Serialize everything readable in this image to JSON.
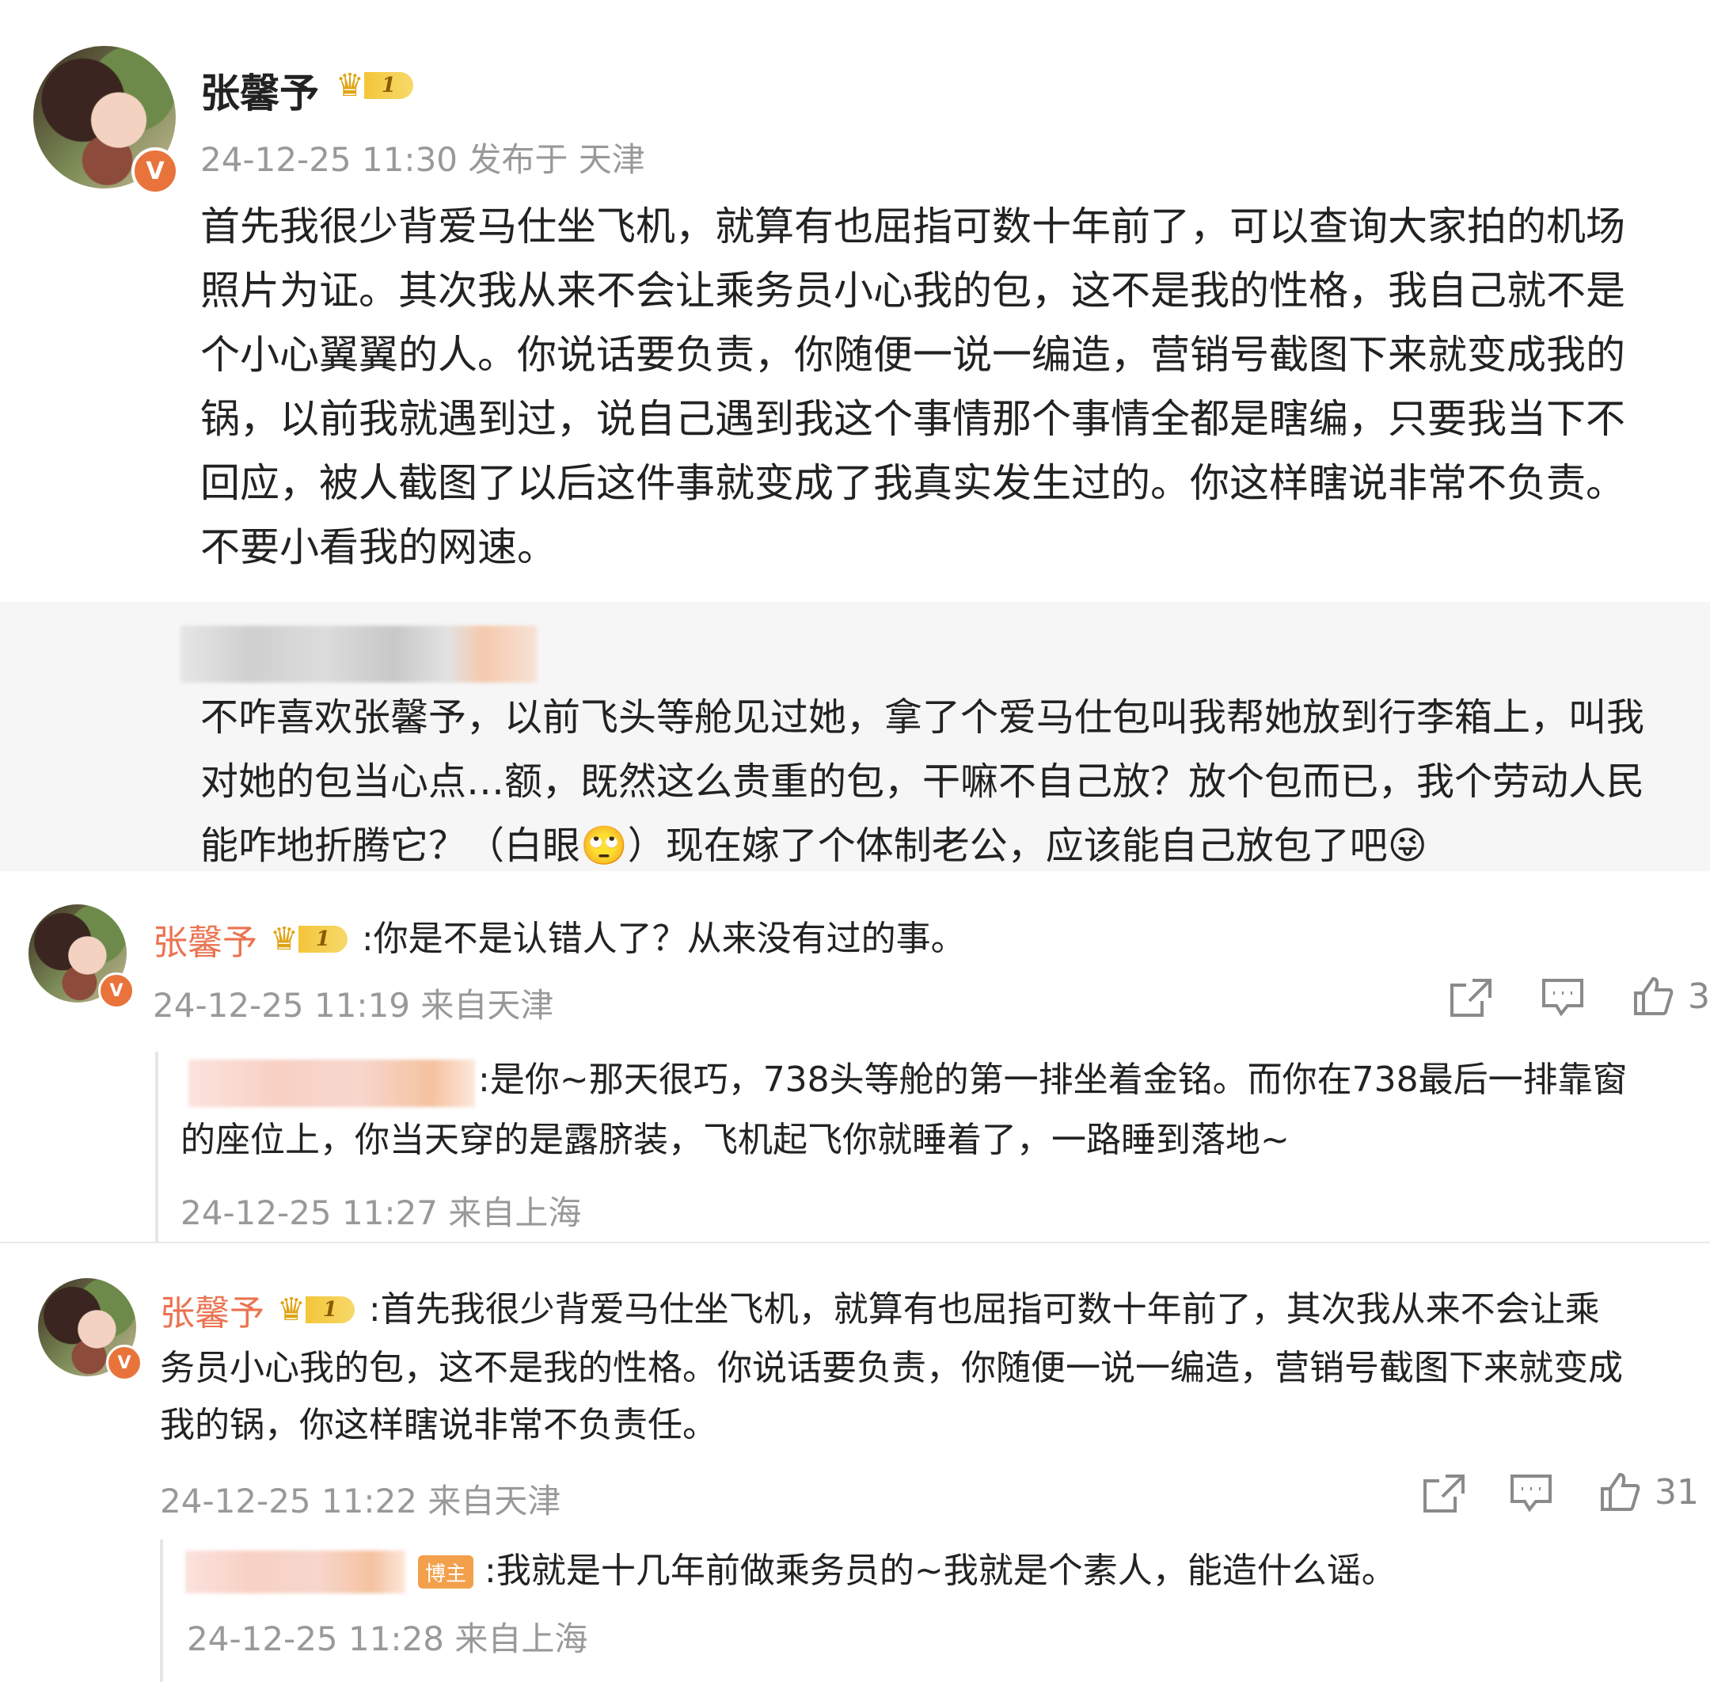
{
  "post": {
    "author": "张馨予",
    "vip_level": "1",
    "verified_mark": "V",
    "meta": "24-12-25 11:30 发布于 天津",
    "lines": [
      "首先我很少背爱马仕坐飞机，就算有也屈指可数十年前了，可以查询大家拍的机场",
      "照片为证。其次我从来不会让乘务员小心我的包，这不是我的性格，我自己就不是",
      "个小心翼翼的人。你说话要负责，你随便一说一编造，营销号截图下来就变成我的",
      "锅，以前我就遇到过，说自己遇到我这个事情那个事情全都是瞎编，只要我当下不",
      "回应，被人截图了以后这件事就变成了我真实发生过的。你这样瞎说非常不负责。",
      "不要小看我的网速。"
    ]
  },
  "quoted": {
    "lines": [
      "不咋喜欢张馨予，以前飞头等舱见过她，拿了个爱马仕包叫我帮她放到行李箱上，叫我",
      "对她的包当心点…额，既然这么贵重的包，干嘛不自己放？放个包而已，我个劳动人民",
      "能咋地折腾它？（白眼🙄）现在嫁了个体制老公，应该能自己放包了吧😜"
    ]
  },
  "comments": [
    {
      "author": "张馨予",
      "vip_level": "1",
      "verified_mark": "V",
      "text_lines": [
        ":你是不是认错人了？从来没有过的事。"
      ],
      "meta": "24-12-25 11:19 来自天津",
      "like_count": "3",
      "reply": {
        "text_lines": [
          ":是你~那天很巧，738头等舱的第一排坐着金铭。而你在738最后一排靠窗",
          "的座位上，你当天穿的是露脐装，飞机起飞你就睡着了，一路睡到落地~"
        ],
        "meta": "24-12-25 11:27 来自上海"
      }
    },
    {
      "author": "张馨予",
      "vip_level": "1",
      "verified_mark": "V",
      "text_lines": [
        ":首先我很少背爱马仕坐飞机，就算有也屈指可数十年前了，其次我从来不会让乘",
        "务员小心我的包，这不是我的性格。你说话要负责，你随便一说一编造，营销号截图下来就变成",
        "我的锅，你这样瞎说非常不负责任。"
      ],
      "meta": "24-12-25 11:22 来自天津",
      "like_count": "31",
      "reply": {
        "badge": "博主",
        "text_lines": [
          ":我就是十几年前做乘务员的~我就是个素人，能造什么谣。"
        ],
        "meta": "24-12-25 11:28 来自上海"
      }
    }
  ],
  "icons": {
    "share": "share-icon",
    "comment": "comment-icon",
    "like": "like-icon"
  }
}
